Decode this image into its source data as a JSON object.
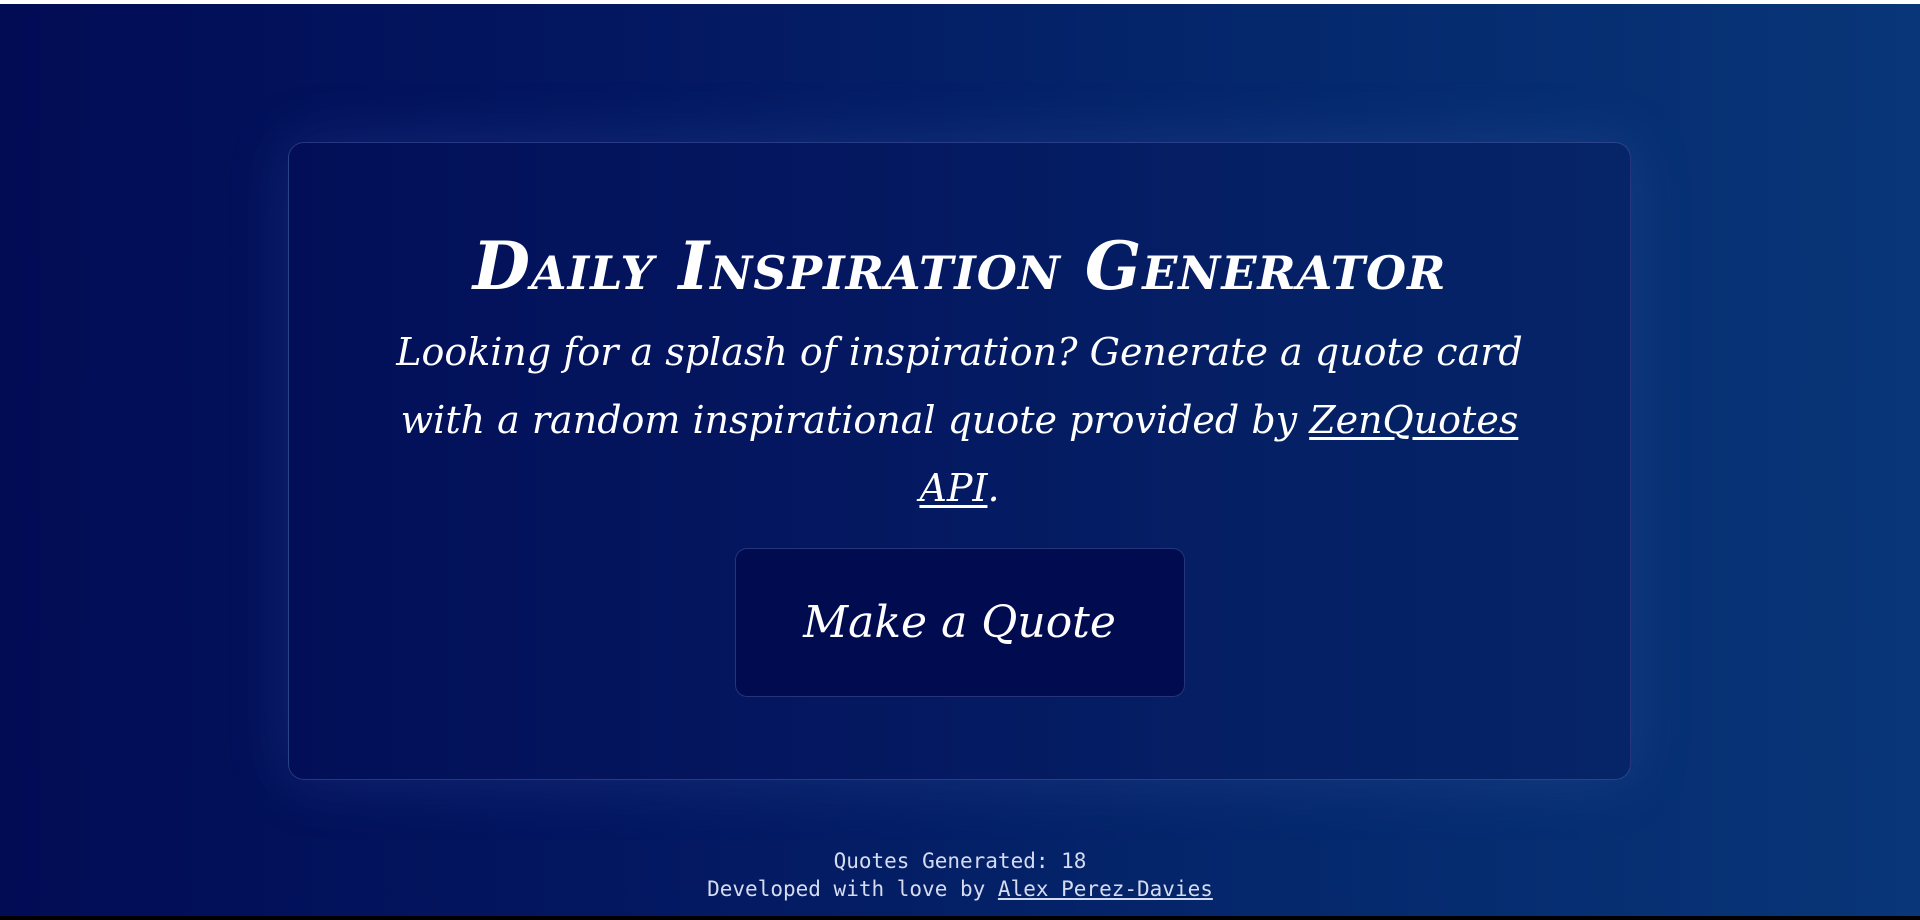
{
  "header": {
    "title": "Daily Inspiration Generator"
  },
  "intro": {
    "text_before_link": "Looking for a splash of inspiration? Generate a quote card with a random inspirational quote provided by ",
    "link_text": "ZenQuotes API",
    "text_after_link": "."
  },
  "actions": {
    "make_quote_label": "Make a Quote"
  },
  "footer": {
    "counter_label": "Quotes Generated: ",
    "counter_value": "18",
    "credit_prefix": "Developed with love by ",
    "author_link": "Alex Perez-Davies"
  },
  "colors": {
    "background_left": "#020c55",
    "background_right": "#083678",
    "card": "#041760",
    "button": "#010b4f",
    "text": "#ffffff"
  }
}
